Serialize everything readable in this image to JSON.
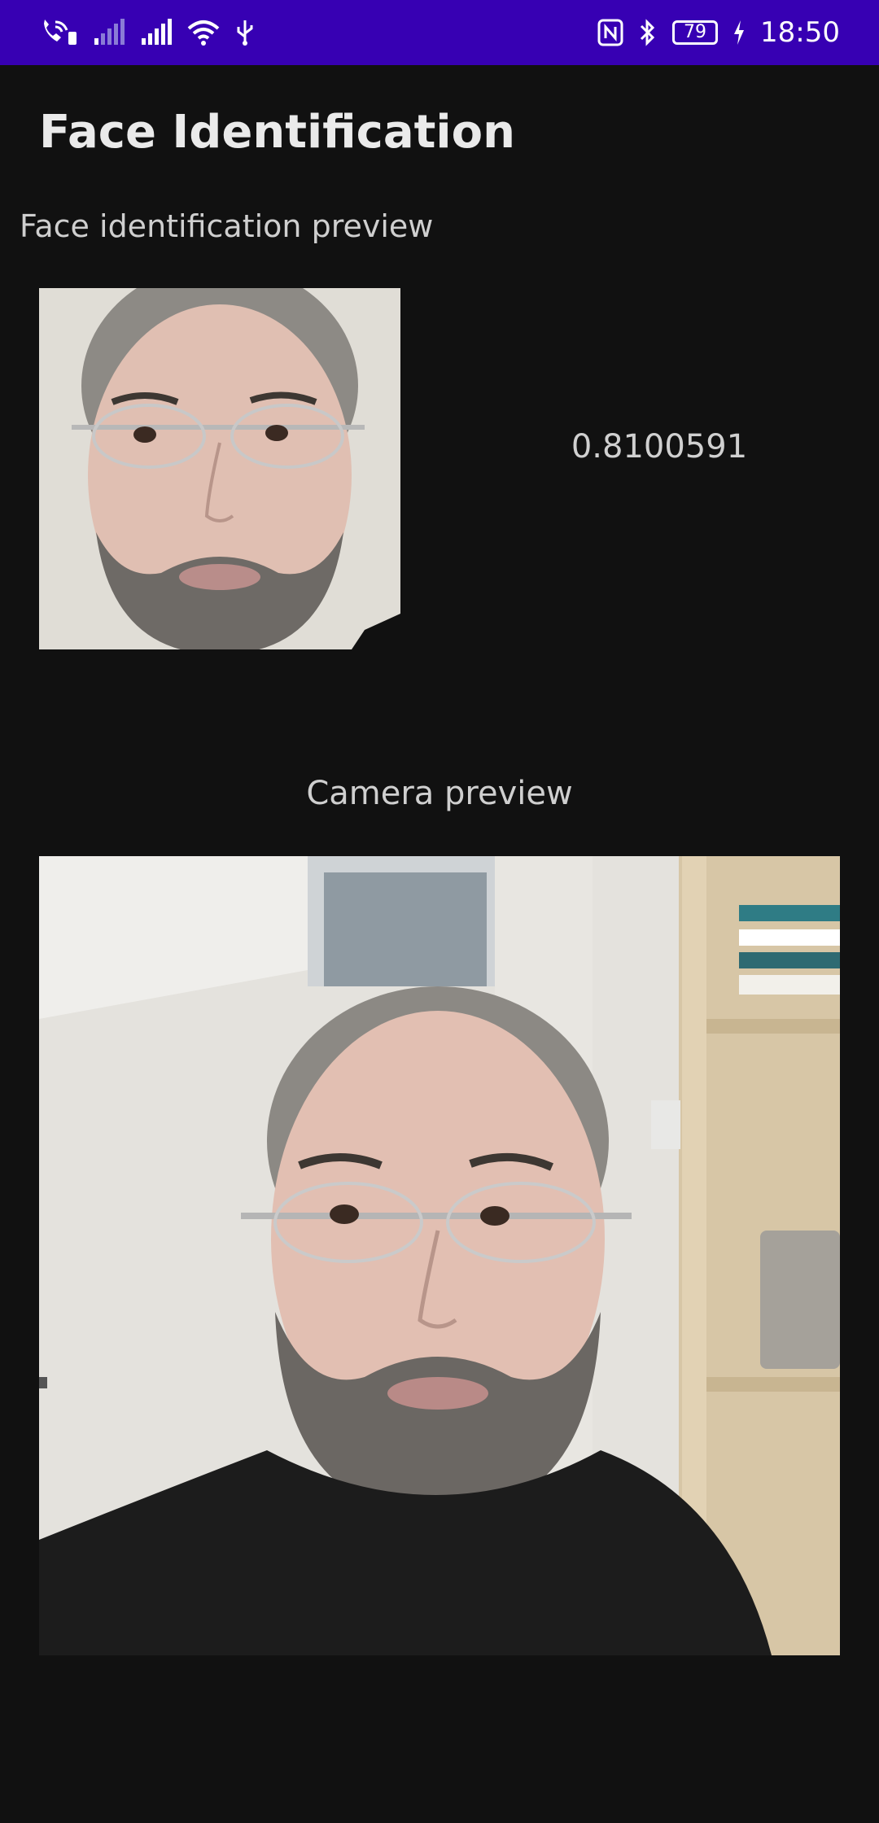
{
  "status_bar": {
    "time": "18:50",
    "battery_level": "79",
    "icons_left": [
      "wifi-calling-icon",
      "signal-weak-icon",
      "signal-strong-icon",
      "wifi-icon",
      "usb-icon"
    ],
    "icons_right": [
      "nfc-icon",
      "bluetooth-icon",
      "battery-icon",
      "charging-icon"
    ],
    "background": "#3700b3"
  },
  "app": {
    "title": "Face Identification",
    "face_preview_label": "Face identification preview",
    "score": "0.8100591",
    "camera_preview_label": "Camera preview"
  },
  "colors": {
    "background": "#111111",
    "text_primary": "#eaeaea",
    "text_secondary": "#cfcfcf"
  }
}
